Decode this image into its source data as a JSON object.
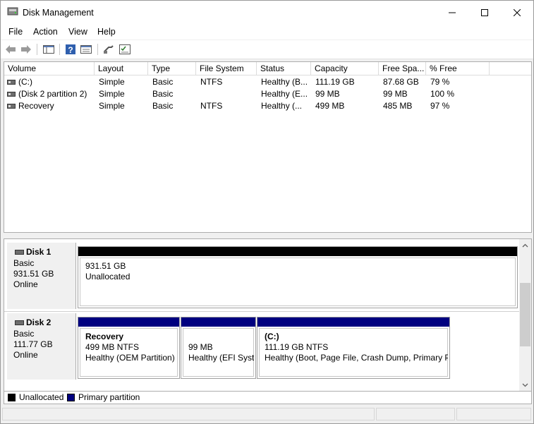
{
  "window": {
    "title": "Disk Management",
    "controls": [
      "minimize-icon",
      "maximize-icon",
      "close-icon"
    ]
  },
  "menu": [
    "File",
    "Action",
    "View",
    "Help"
  ],
  "toolbar": [
    "back-icon",
    "forward-icon",
    "console-tree-icon",
    "help-icon",
    "properties-icon",
    "connect-icon",
    "checklist-icon"
  ],
  "list": {
    "columns": [
      "Volume",
      "Layout",
      "Type",
      "File System",
      "Status",
      "Capacity",
      "Free Spa...",
      "% Free"
    ],
    "rows": [
      [
        "(C:)",
        "Simple",
        "Basic",
        "NTFS",
        "Healthy (B...",
        "111.19 GB",
        "87.68 GB",
        "79 %"
      ],
      [
        "(Disk 2 partition 2)",
        "Simple",
        "Basic",
        "",
        "Healthy (E...",
        "99 MB",
        "99 MB",
        "100 %"
      ],
      [
        "Recovery",
        "Simple",
        "Basic",
        "NTFS",
        "Healthy (...",
        "499 MB",
        "485 MB",
        "97 %"
      ]
    ]
  },
  "disks": [
    {
      "name": "Disk 1",
      "type": "Basic",
      "size": "931.51 GB",
      "state": "Online",
      "partitions": [
        {
          "title": "",
          "line1": "931.51 GB",
          "line2": "Unallocated",
          "kind": "unallocated"
        }
      ]
    },
    {
      "name": "Disk 2",
      "type": "Basic",
      "size": "111.77 GB",
      "state": "Online",
      "partitions": [
        {
          "title": "Recovery",
          "line1": "499 MB NTFS",
          "line2": "Healthy (OEM Partition)",
          "kind": "primary"
        },
        {
          "title": "",
          "line1": "99 MB",
          "line2": "Healthy (EFI Syste",
          "kind": "primary"
        },
        {
          "title": "(C:)",
          "line1": "111.19 GB NTFS",
          "line2": "Healthy (Boot, Page File, Crash Dump, Primary Pa",
          "kind": "primary"
        }
      ]
    }
  ],
  "legend": [
    {
      "label": "Unallocated",
      "color": "#000000"
    },
    {
      "label": "Primary partition",
      "color": "#000080"
    }
  ],
  "colors": {
    "unallocated": "#000000",
    "primary": "#000080"
  }
}
